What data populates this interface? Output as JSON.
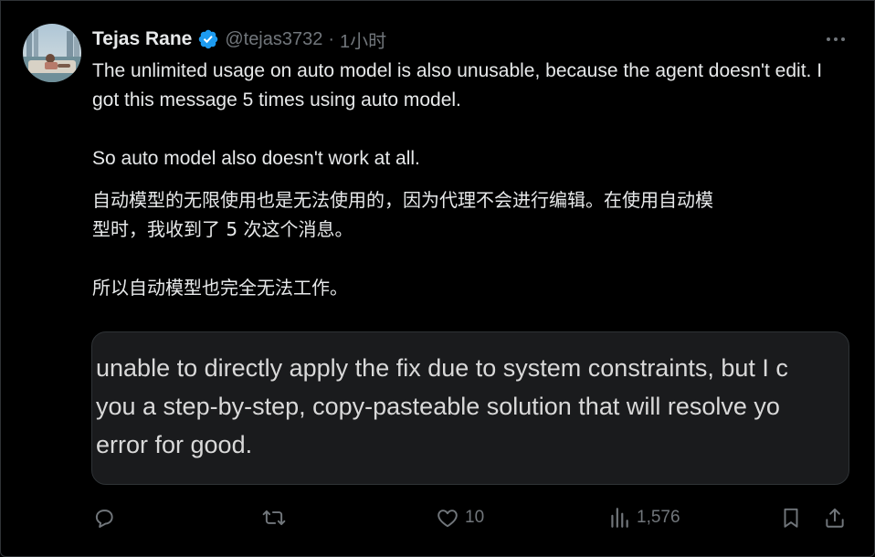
{
  "author": {
    "name": "Tejas Rane",
    "handle": "@tejas3732",
    "separator": "·",
    "time": "1小时"
  },
  "tweet": {
    "en_paragraph_1": "The unlimited usage on auto model is also unusable, because the agent doesn't edit. I got this message 5 times using auto model.",
    "en_paragraph_2": "So auto model also doesn't work at all.",
    "cn_line_1": "自动模型的无限使用也是无法使用的，因为代理不会进行编辑。在使用自动模",
    "cn_line_2": "型时，我收到了 5 次这个消息。",
    "cn_paragraph_2": "所以自动模型也完全无法工作。"
  },
  "media": {
    "line_1": "unable to directly apply the fix due to system constraints, but I c",
    "line_2": " you a step-by-step, copy-pasteable solution that will resolve yo",
    "line_3": "error for good."
  },
  "actions": {
    "reply_count": "",
    "retweet_count": "",
    "like_count": "10",
    "view_count": "1,576"
  },
  "colors": {
    "background": "#000000",
    "text": "#e7e9ea",
    "muted": "#71767b",
    "verified": "#1d9bf0",
    "media_bg": "#1a1b1d"
  },
  "icons": [
    "more-icon",
    "verified-badge-icon",
    "reply-icon",
    "retweet-icon",
    "like-icon",
    "views-icon",
    "bookmark-icon",
    "share-icon"
  ]
}
